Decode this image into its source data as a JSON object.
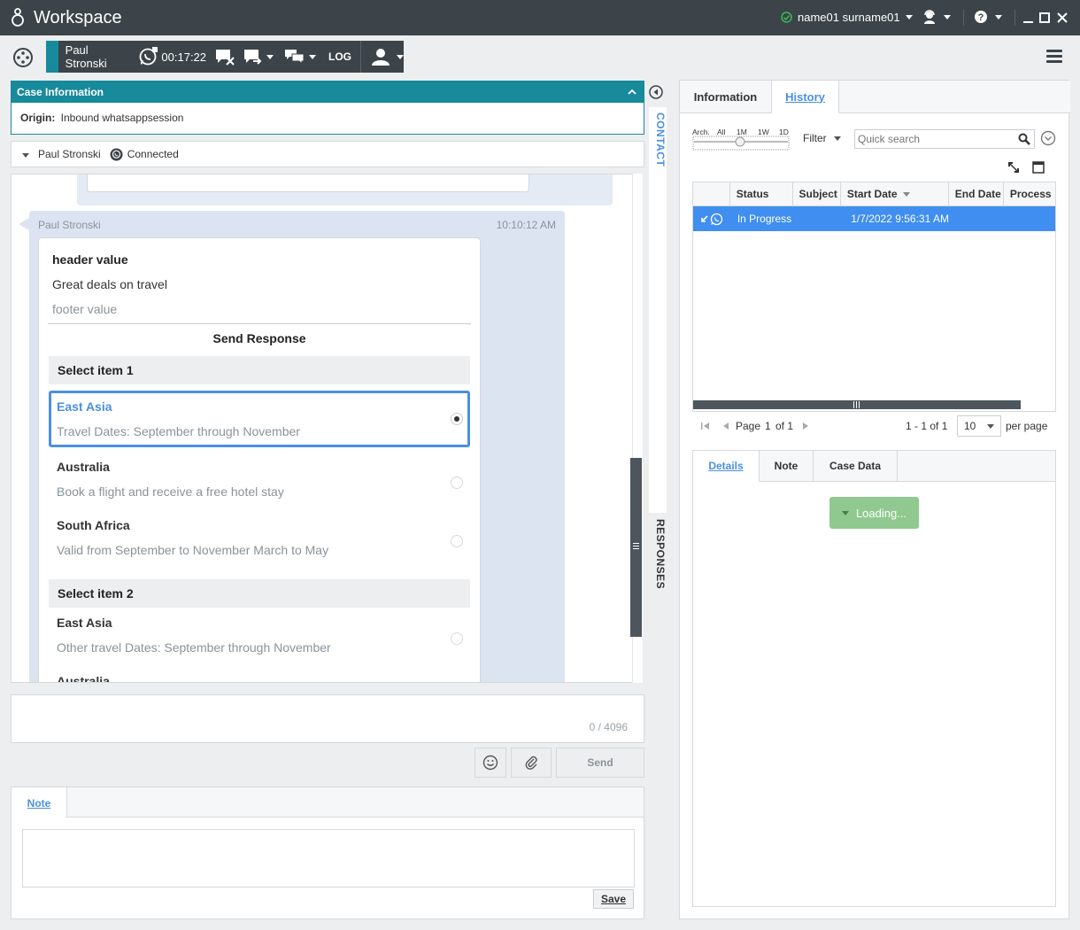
{
  "app": {
    "title": "Workspace",
    "user_name": "name01 surname01",
    "colors": {
      "titlebar": "#3c4449",
      "teal": "#178a9c",
      "accent": "#4a90e2",
      "status_ok": "#3cba54",
      "loading": "#8fc98f"
    }
  },
  "interaction": {
    "contact_name": "Paul Stronski",
    "timer": "00:17:22",
    "log_label": "LOG",
    "channel_icon": "whatsapp-icon"
  },
  "case_info": {
    "title": "Case Information",
    "origin_label": "Origin:",
    "origin_value": "Inbound whatsappsession"
  },
  "contact_row": {
    "name": "Paul Stronski",
    "status": "Connected"
  },
  "message": {
    "sender": "Paul Stronski",
    "time": "10:10:12 AM",
    "header": "header value",
    "body": "Great deals on travel",
    "footer": "footer value",
    "action_title": "Send Response",
    "sections": [
      {
        "title": "Select item 1",
        "items": [
          {
            "title": "East Asia",
            "desc": "Travel Dates: September through November",
            "selected": true
          },
          {
            "title": "Australia",
            "desc": "Book a flight and receive a free hotel stay",
            "selected": false
          },
          {
            "title": "South Africa",
            "desc": "Valid from September to November March to May",
            "selected": false
          }
        ]
      },
      {
        "title": "Select item 2",
        "items": [
          {
            "title": "East Asia",
            "desc": "Other  travel Dates: September through November",
            "selected": false
          },
          {
            "title": "Australia",
            "desc": "",
            "selected": false
          }
        ]
      }
    ]
  },
  "side_tabs": {
    "contact": "CONTACT",
    "responses": "RESPONSES"
  },
  "composer": {
    "value": "",
    "char_count": "0 / 4096",
    "send_label": "Send"
  },
  "note": {
    "tab_label": "Note",
    "value": "",
    "save_label": "Save"
  },
  "right": {
    "tabs": [
      "Information",
      "History"
    ],
    "active_tab": "History",
    "timeline": {
      "labels": [
        "Arch.",
        "All",
        "1M",
        "1W",
        "1D"
      ]
    },
    "filter_label": "Filter",
    "search_placeholder": "Quick search",
    "grid": {
      "columns": [
        "",
        "Status",
        "Subject",
        "Start Date",
        "End Date",
        "Process"
      ],
      "rows": [
        {
          "status": "In Progress",
          "subject": "",
          "start_date": "1/7/2022 9:56:31 AM",
          "end_date": "",
          "process": ""
        }
      ]
    },
    "pager": {
      "page_label": "Page",
      "page": "1",
      "of_label": "of 1",
      "range": "1 - 1 of 1",
      "per_page_value": "10",
      "per_page_label": "per page"
    },
    "details_tabs": [
      "Details",
      "Note",
      "Case Data"
    ],
    "loading_label": "Loading..."
  }
}
